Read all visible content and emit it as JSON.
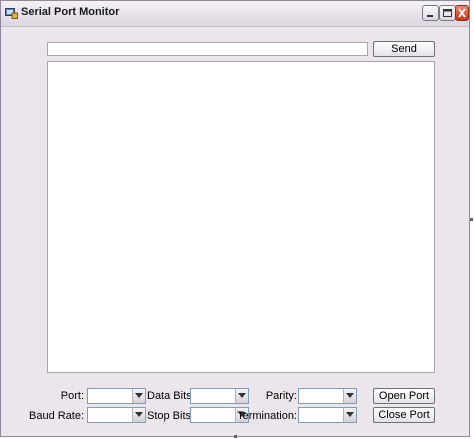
{
  "window": {
    "title": "Serial Port Monitor",
    "icon": "serial-port-app-icon",
    "controls": [
      "minimize-icon",
      "maximize-icon",
      "close-icon"
    ]
  },
  "send": {
    "input_value": "",
    "button_label": "Send"
  },
  "output": {
    "text": ""
  },
  "settings": {
    "port": {
      "label": "Port:",
      "value": ""
    },
    "baud_rate": {
      "label": "Baud Rate:",
      "value": ""
    },
    "data_bits": {
      "label": "Data Bits:",
      "value": ""
    },
    "stop_bits": {
      "label": "Stop Bits:",
      "value": ""
    },
    "parity": {
      "label": "Parity:",
      "value": ""
    },
    "termination": {
      "label": "Termination:",
      "value": ""
    }
  },
  "actions": {
    "open_port_label": "Open Port",
    "close_port_label": "Close Port"
  },
  "colors": {
    "window_background": "#ece6ec",
    "close_button": "#c4361b"
  }
}
